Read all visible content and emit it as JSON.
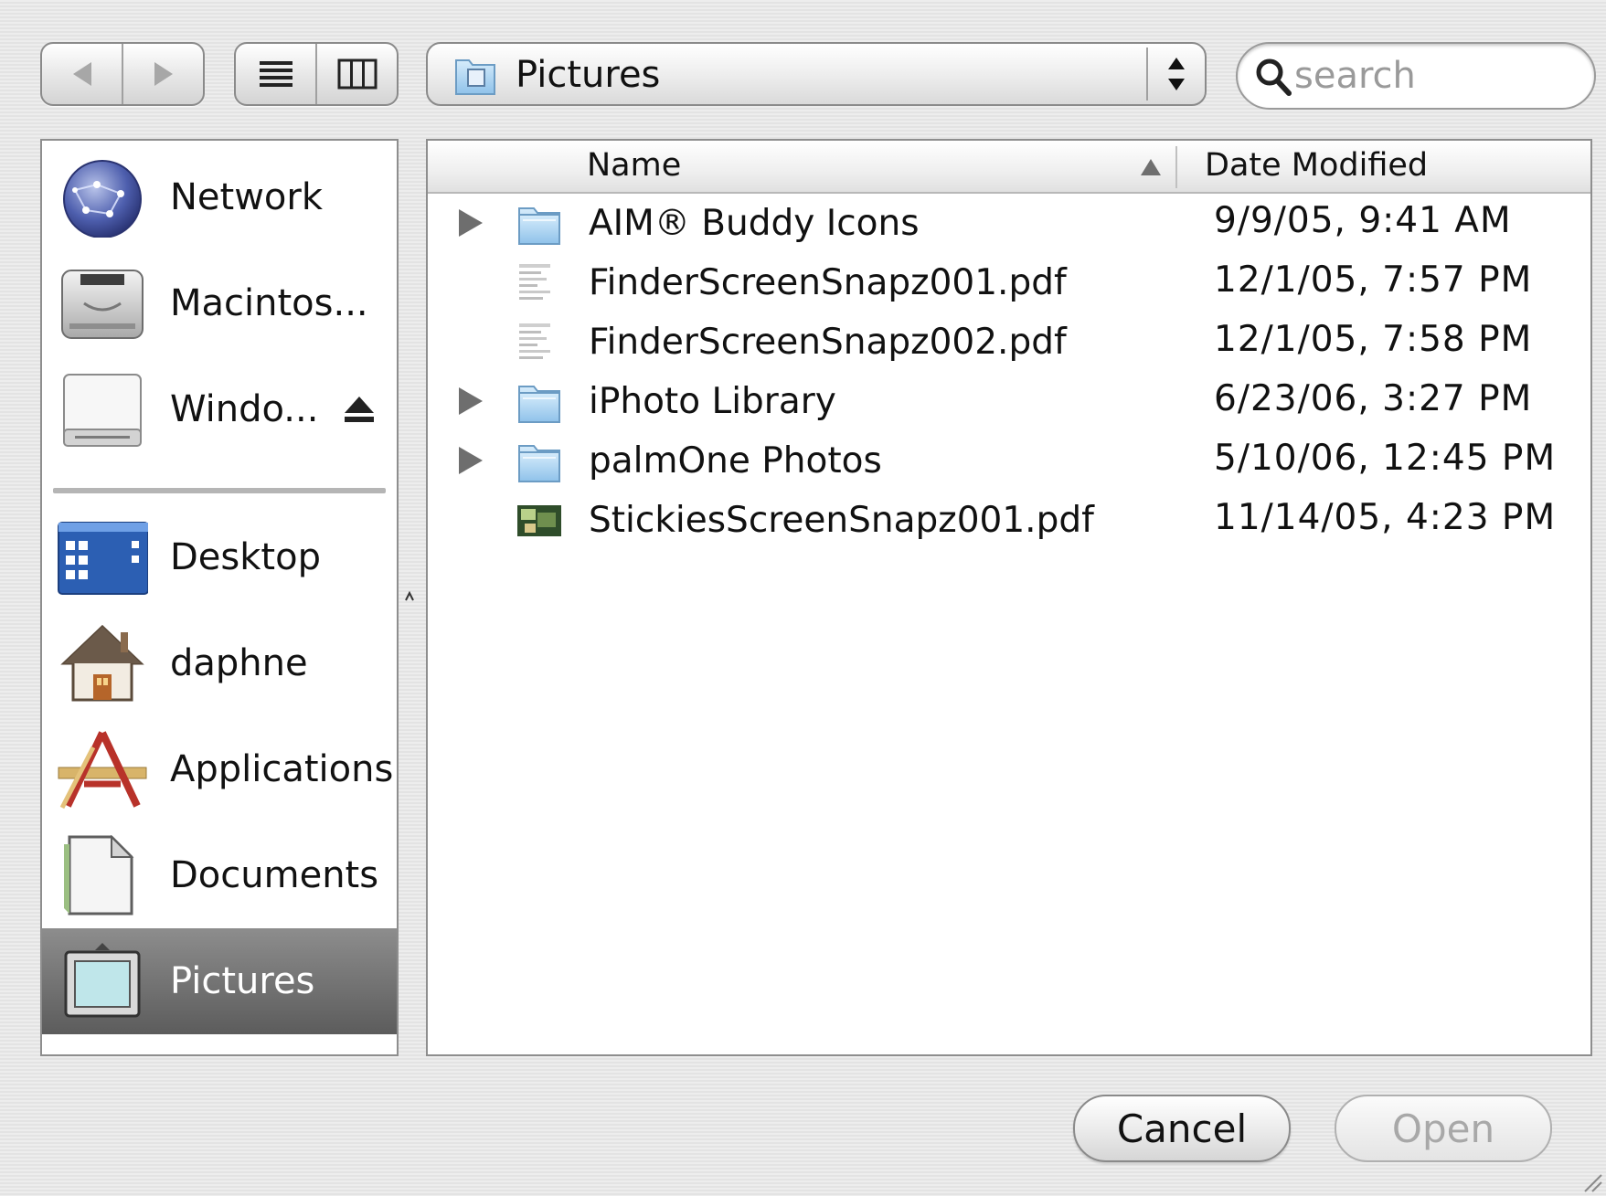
{
  "toolbar": {
    "location_label": "Pictures",
    "search_placeholder": "search"
  },
  "sidebar": {
    "devices": [
      {
        "label": "Network",
        "icon": "network-globe-icon"
      },
      {
        "label": "Macintos...",
        "icon": "hard-drive-icon"
      },
      {
        "label": "Windo...",
        "icon": "external-drive-icon"
      }
    ],
    "places": [
      {
        "label": "Desktop",
        "icon": "desktop-icon"
      },
      {
        "label": "daphne",
        "icon": "home-icon"
      },
      {
        "label": "Applications",
        "icon": "applications-icon"
      },
      {
        "label": "Documents",
        "icon": "documents-icon"
      },
      {
        "label": "Pictures",
        "icon": "pictures-icon",
        "selected": true
      }
    ]
  },
  "file_list": {
    "columns": {
      "name": "Name",
      "date": "Date Modified"
    },
    "rows": [
      {
        "name": "AIM® Buddy Icons",
        "date": "9/9/05, 9:41 AM",
        "kind": "folder"
      },
      {
        "name": "FinderScreenSnapz001.pdf",
        "date": "12/1/05, 7:57 PM",
        "kind": "pdf"
      },
      {
        "name": "FinderScreenSnapz002.pdf",
        "date": "12/1/05, 7:58 PM",
        "kind": "pdf"
      },
      {
        "name": "iPhoto Library",
        "date": "6/23/06, 3:27 PM",
        "kind": "folder"
      },
      {
        "name": "palmOne Photos",
        "date": "5/10/06, 12:45 PM",
        "kind": "folder"
      },
      {
        "name": "StickiesScreenSnapz001.pdf",
        "date": "11/14/05, 4:23 PM",
        "kind": "pdf-image"
      }
    ]
  },
  "buttons": {
    "cancel": "Cancel",
    "open": "Open"
  }
}
